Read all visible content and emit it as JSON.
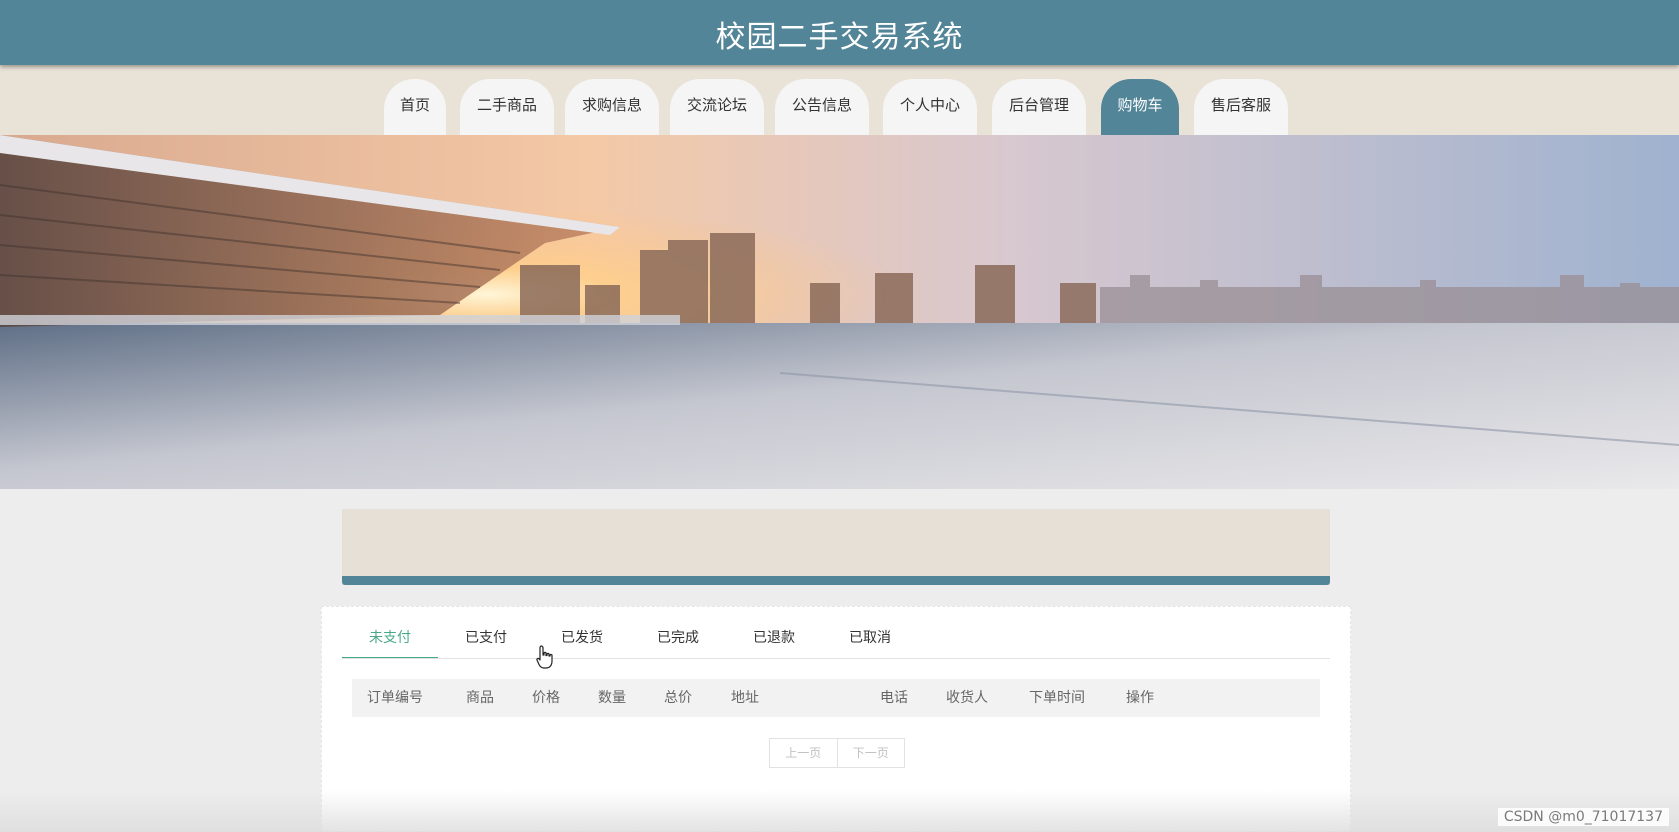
{
  "header": {
    "title": "校园二手交易系统"
  },
  "nav": {
    "items": [
      {
        "label": "首页"
      },
      {
        "label": "二手商品"
      },
      {
        "label": "求购信息"
      },
      {
        "label": "交流论坛"
      },
      {
        "label": "公告信息"
      },
      {
        "label": "个人中心"
      },
      {
        "label": "后台管理"
      },
      {
        "label": "购物车"
      },
      {
        "label": "售后客服"
      }
    ],
    "active": "购物车"
  },
  "tabs": {
    "items": [
      {
        "label": "未支付"
      },
      {
        "label": "已支付"
      },
      {
        "label": "已发货"
      },
      {
        "label": "已完成"
      },
      {
        "label": "已退款"
      },
      {
        "label": "已取消"
      }
    ],
    "active": "未支付"
  },
  "table": {
    "columns": [
      "订单编号",
      "商品",
      "价格",
      "数量",
      "总价",
      "地址",
      "电话",
      "收货人",
      "下单时间",
      "操作"
    ],
    "rows": []
  },
  "pagination": {
    "prev_label": "上一页",
    "next_label": "下一页"
  },
  "watermark": "CSDN @m0_71017137",
  "colors": {
    "primary": "#528597",
    "accent": "#4aa88a",
    "nav_background": "#e9e2d7"
  }
}
